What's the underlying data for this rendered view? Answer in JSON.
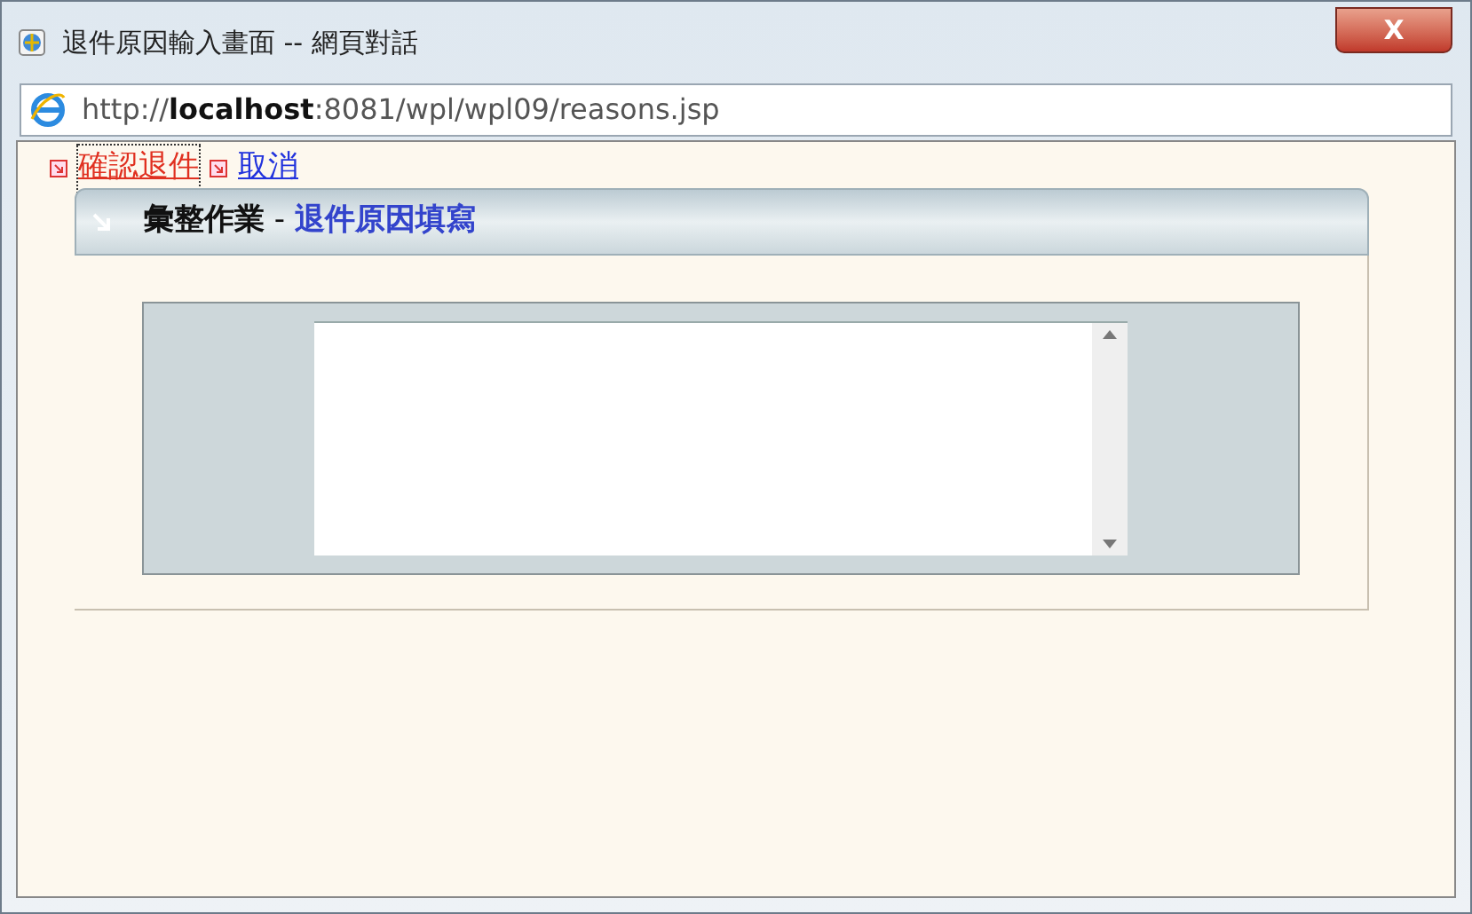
{
  "window": {
    "title": "退件原因輸入畫面 -- 網頁對話",
    "close_label": "X"
  },
  "address_bar": {
    "prefix": "http://",
    "host": "localhost",
    "rest": ":8081/wpl/wpl09/reasons.jsp"
  },
  "links": [
    {
      "label": "確認退件",
      "focused": true
    },
    {
      "label": "取消",
      "focused": false
    }
  ],
  "panel": {
    "title": "彙整作業",
    "separator": " - ",
    "subtitle": "退件原因填寫"
  }
}
